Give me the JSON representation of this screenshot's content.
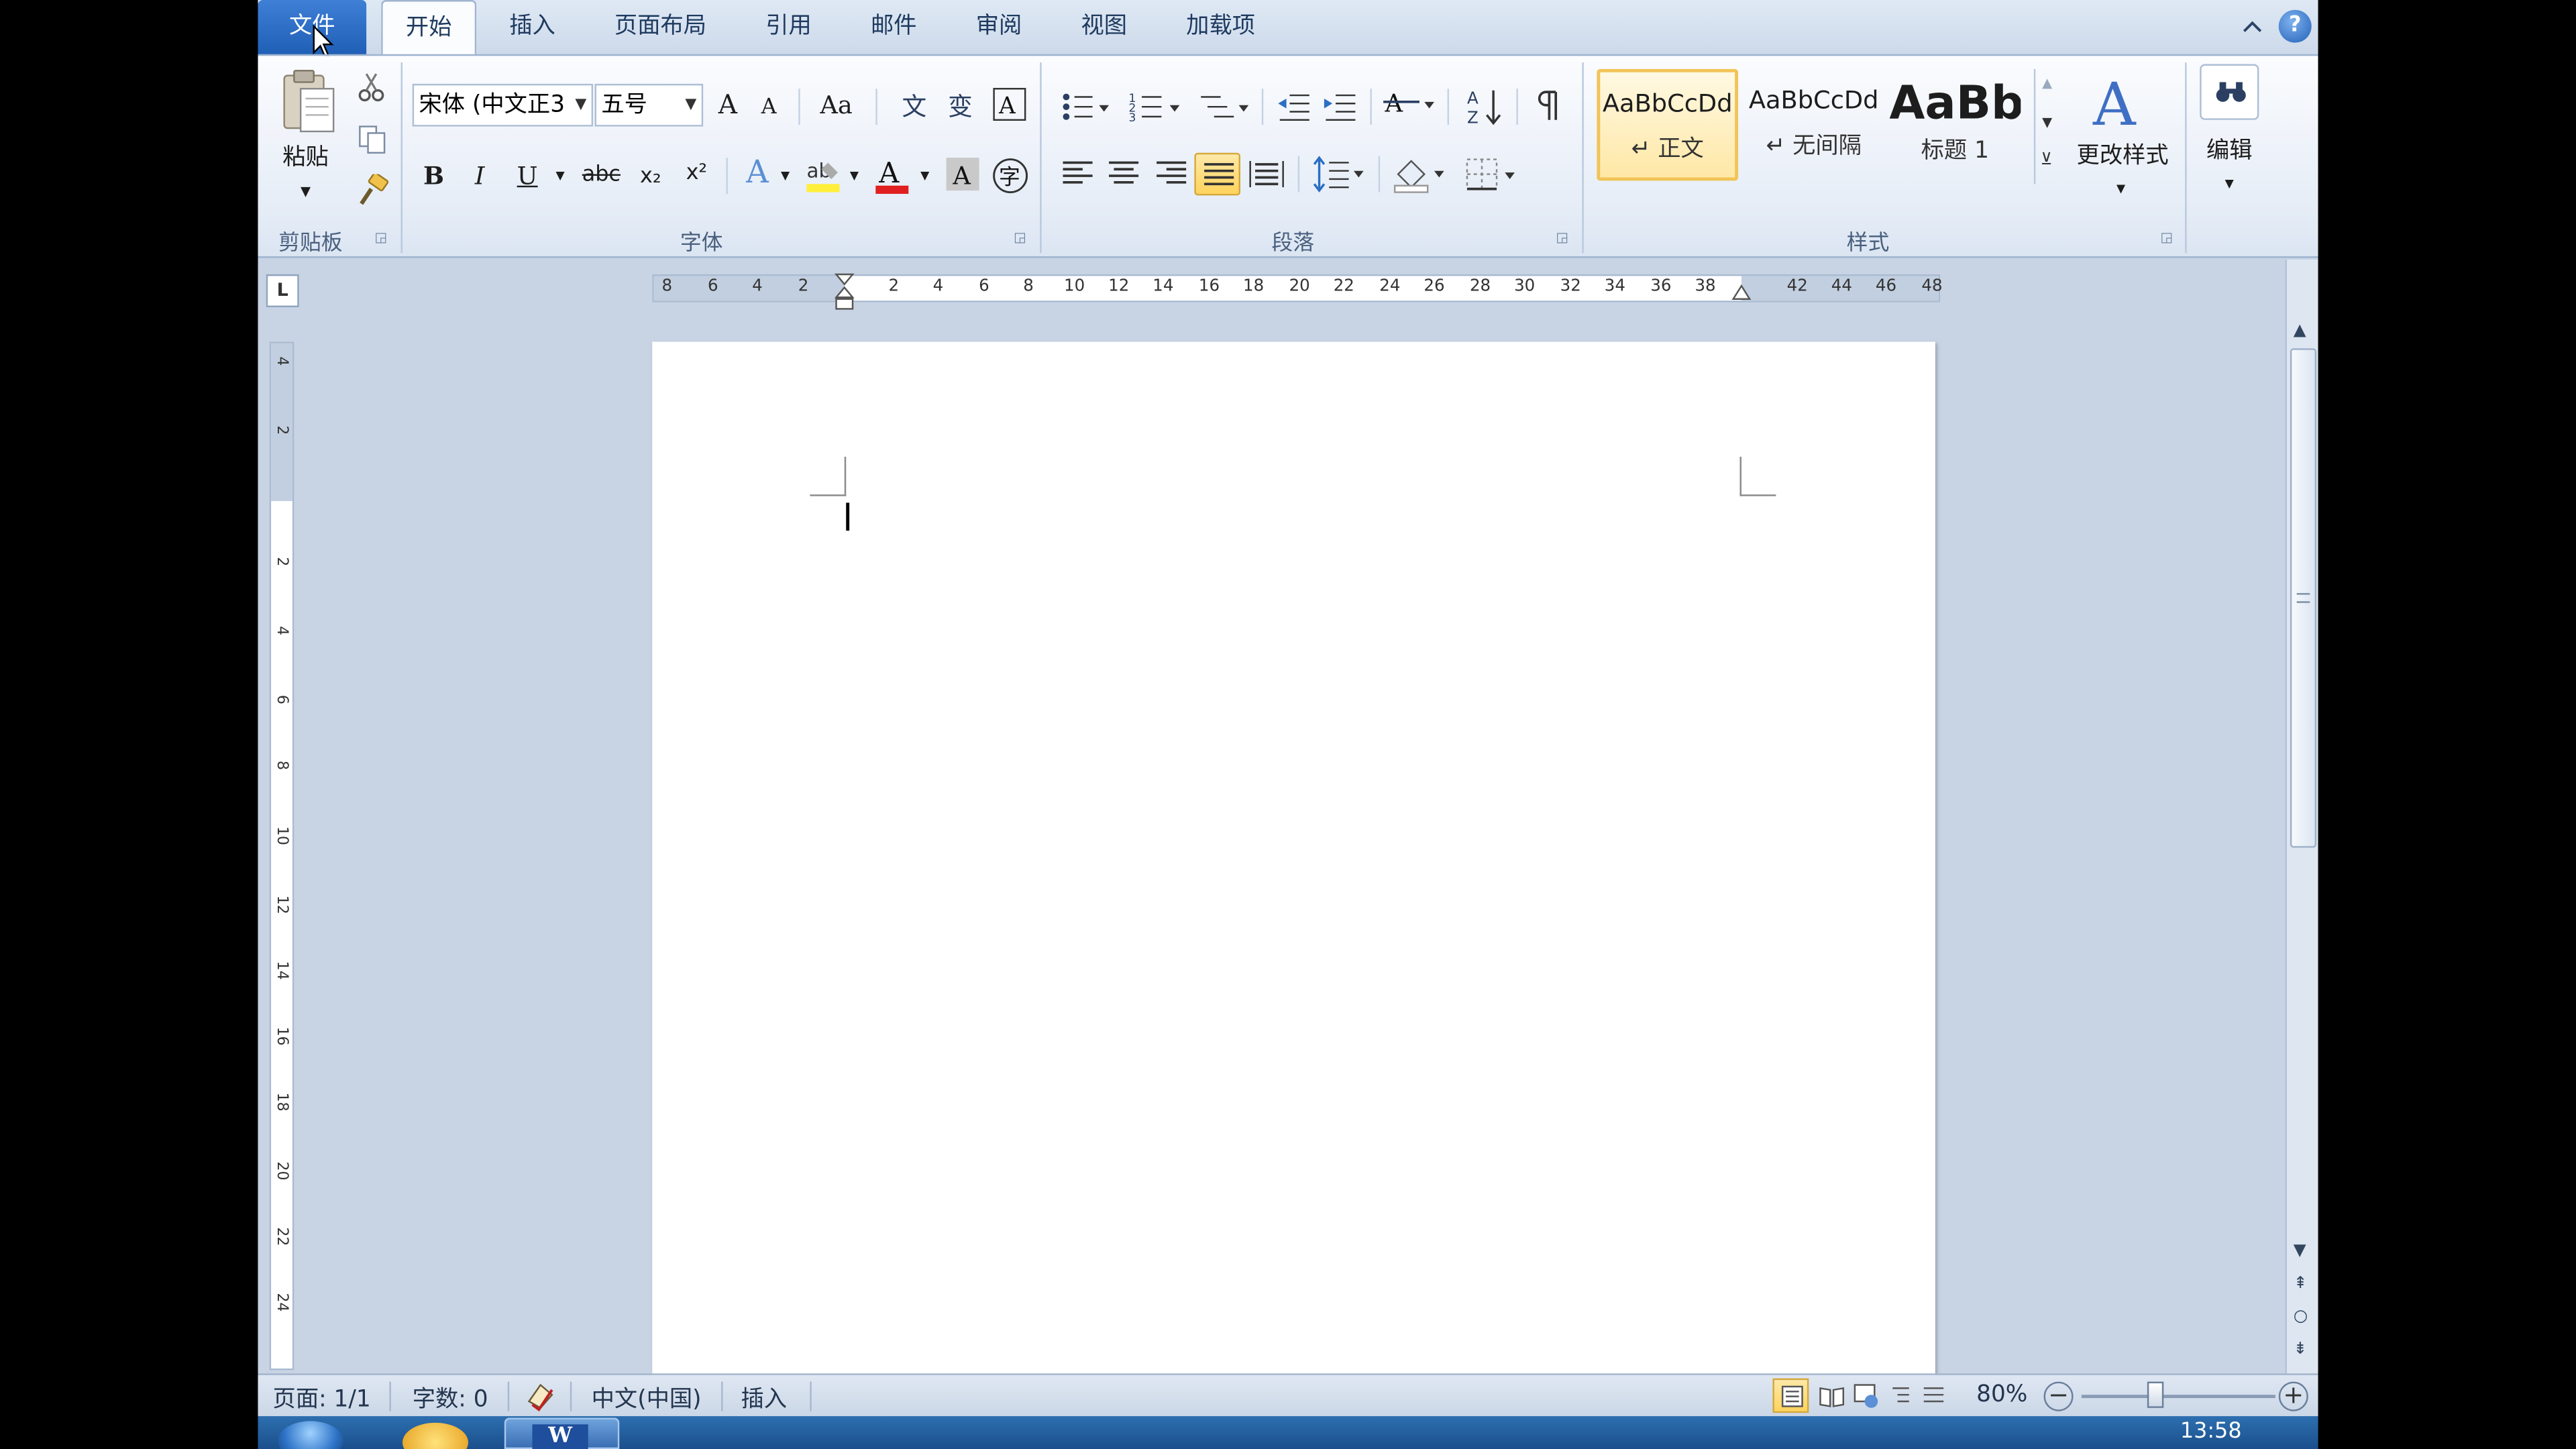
{
  "tabs": {
    "file": "文件",
    "home": "开始",
    "insert": "插入",
    "page_layout": "页面布局",
    "references": "引用",
    "mailings": "邮件",
    "review": "审阅",
    "view": "视图",
    "addins": "加载项"
  },
  "clipboard": {
    "paste_label": "粘贴",
    "group_label": "剪贴板"
  },
  "font": {
    "font_name": "宋体 (中文正3",
    "font_size": "五号",
    "grow_label": "A",
    "shrink_label": "A",
    "change_case_label": "Aa",
    "bold_label": "B",
    "italic_label": "I",
    "underline_label": "U",
    "strike_label": "abc",
    "subscript_label": "x₂",
    "superscript_label": "x²",
    "effects_label": "A",
    "color_label": "A",
    "shading_label": "A",
    "enclose_label": "字",
    "group_label": "字体"
  },
  "paragraph": {
    "group_label": "段落"
  },
  "styles": {
    "items": [
      {
        "sample": "AaBbCcDd",
        "name": "↵ 正文"
      },
      {
        "sample": "AaBbCcDd",
        "name": "↵ 无间隔"
      },
      {
        "sample": "AaBb",
        "name": "标题 1"
      }
    ],
    "change_styles_label": "更改样式",
    "group_label": "样式"
  },
  "editing": {
    "label": "编辑"
  },
  "ruler": {
    "h_numbers": [
      "8",
      "6",
      "4",
      "2",
      "2",
      "4",
      "6",
      "8",
      "10",
      "12",
      "14",
      "16",
      "18",
      "20",
      "22",
      "24",
      "26",
      "28",
      "30",
      "32",
      "34",
      "36",
      "38",
      "42",
      "44",
      "46",
      "48"
    ],
    "v_numbers": [
      "4",
      "2",
      "2",
      "4",
      "6",
      "8",
      "10",
      "12",
      "14",
      "16",
      "18",
      "20",
      "22",
      "24"
    ]
  },
  "status": {
    "page": "页面: 1/1",
    "words": "字数: 0",
    "language": "中文(中国)",
    "mode": "插入",
    "zoom": "80%"
  },
  "taskbar": {
    "time": "13:58"
  },
  "colors": {
    "file_tab": "#2f6fc6",
    "accent_yellow": "#f2c356",
    "font_color_red": "#e02020",
    "highlight_yellow": "#ffef3a"
  }
}
